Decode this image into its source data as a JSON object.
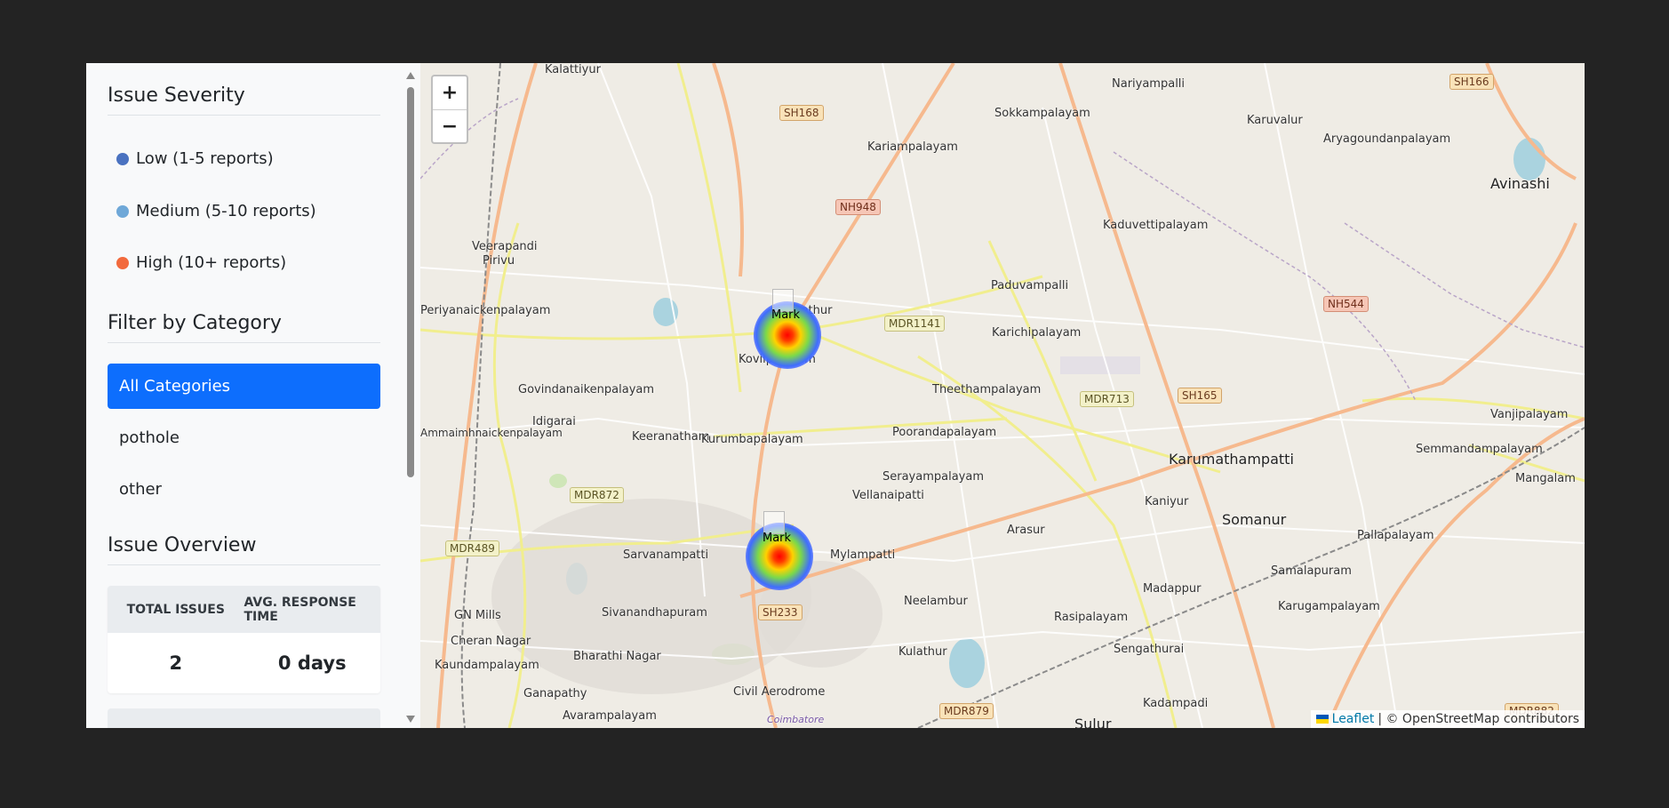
{
  "sidebar": {
    "severity_title": "Issue Severity",
    "severity_levels": [
      {
        "label": "Low (1-5 reports)",
        "color": "#4a72c0"
      },
      {
        "label": "Medium (5-10 reports)",
        "color": "#6fa8d8"
      },
      {
        "label": "High (10+ reports)",
        "color": "#f26a3d"
      }
    ],
    "category_title": "Filter by Category",
    "categories": [
      "All Categories",
      "pothole",
      "other"
    ],
    "active_category": "All Categories",
    "overview_title": "Issue Overview",
    "overview": {
      "headers": [
        "TOTAL ISSUES",
        "AVG. RESPONSE TIME"
      ],
      "values": [
        "2",
        "0 days"
      ]
    }
  },
  "map": {
    "zoom_in": "+",
    "zoom_out": "−",
    "places": [
      "Kalattiyur",
      "Nariyampalli",
      "Sokkampalayam",
      "Kariampalayam",
      "Karuvalur",
      "Aryagoundanpalayam",
      "Avinashi",
      "Kaduvettipalayam",
      "Veerapandi",
      "Pirivu",
      "Periyanaickenpalayam",
      "Kunnathur",
      "Paduvampalli",
      "Karichipalayam",
      "Kovilpalayam",
      "Govindanaikenpalayam",
      "Theethampalayam",
      "Idigarai",
      "Keeranatham",
      "Kurumbapalayam",
      "Poorandapalayam",
      "Karumathampatti",
      "Vanjipalayam",
      "Semmandampalayam",
      "Mangalam",
      "Serayampalayam",
      "Vellanaipatti",
      "Kaniyur",
      "Arasur",
      "Somanur",
      "Pallapalayam",
      "Sarvanampatti",
      "Mylampatti",
      "Madappur",
      "Samalapuram",
      "Sivanandhapuram",
      "Neelambur",
      "Rasipalayam",
      "Karugampalayam",
      "GN Mills",
      "Cheran Nagar",
      "Kaundampalayam",
      "Bharathi Nagar",
      "Kulathur",
      "Sengathurai",
      "Ganapathy",
      "Civil Aerodrome",
      "Kadampadi",
      "Avarampalayam",
      "Coimbatore",
      "Sulur",
      "Ammaimhnaickenpalayam"
    ],
    "road_shields": [
      "SH168",
      "NH948",
      "SH166",
      "MDR1141",
      "NH544",
      "MDR713",
      "SH165",
      "MDR872",
      "MDR489",
      "SH233",
      "MDR879",
      "MDR882"
    ],
    "markers": [
      {
        "label": "Mark"
      },
      {
        "label": "Mark"
      }
    ],
    "attribution": {
      "leaflet": "Leaflet",
      "text": "| © OpenStreetMap contributors"
    }
  }
}
